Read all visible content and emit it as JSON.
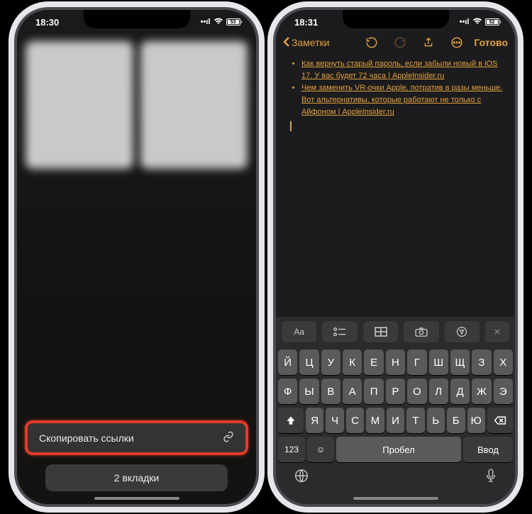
{
  "left": {
    "time": "18:30",
    "battery": "53",
    "copy_links_label": "Скопировать ссылки",
    "tabs_label": "2 вкладки"
  },
  "right": {
    "time": "18:31",
    "battery": "52",
    "back_label": "Заметки",
    "done_label": "Готово",
    "note_links": [
      "Как вернуть старый пароль, если забыли новый в iOS 17. У вас будет 72 часа | AppleInsider.ru",
      "Чем заменить VR-очки Apple, потратив в разы меньше. Вот альтернативы, которые работают не только с Айфоном | AppleInsider.ru"
    ],
    "tools": {
      "aa": "Aa"
    },
    "keys": {
      "row1": [
        "Й",
        "Ц",
        "У",
        "К",
        "Е",
        "Н",
        "Г",
        "Ш",
        "Щ",
        "З",
        "Х"
      ],
      "row2": [
        "Ф",
        "Ы",
        "В",
        "А",
        "П",
        "Р",
        "О",
        "Л",
        "Д",
        "Ж",
        "Э"
      ],
      "row3": [
        "Я",
        "Ч",
        "С",
        "М",
        "И",
        "Т",
        "Ь",
        "Б",
        "Ю"
      ],
      "num": "123",
      "space": "Пробел",
      "enter": "Ввод"
    }
  }
}
